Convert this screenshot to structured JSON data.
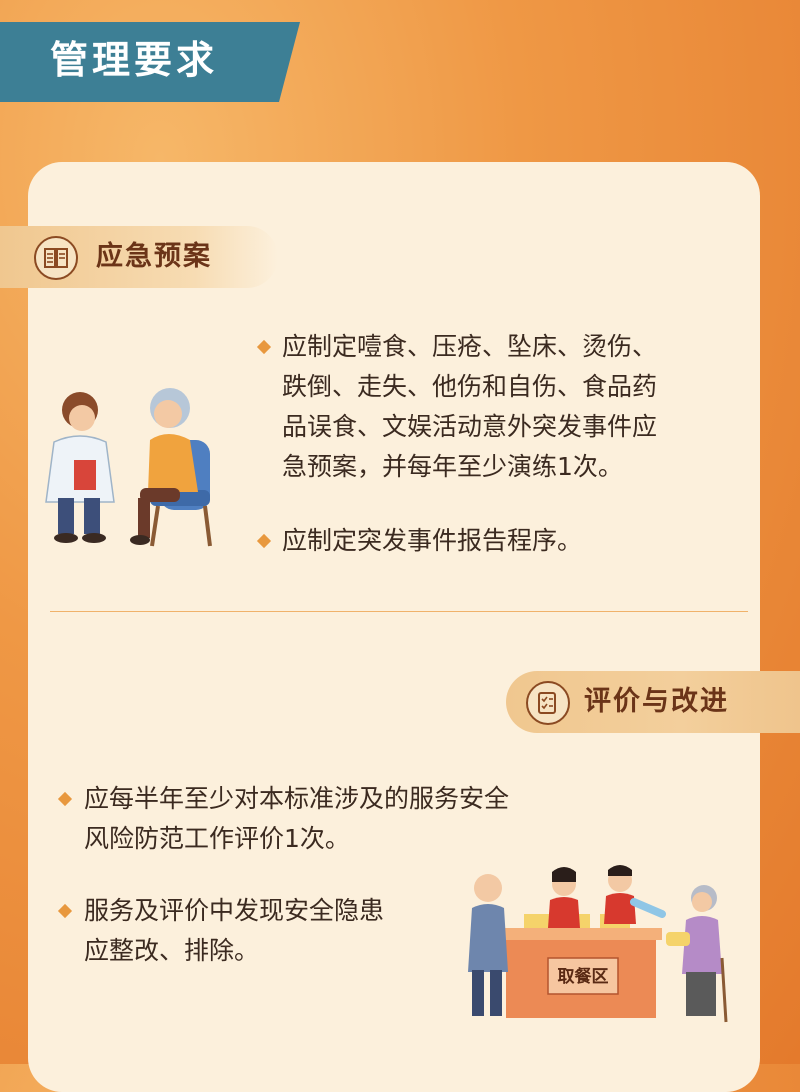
{
  "header": {
    "title": "管理要求"
  },
  "sections": [
    {
      "heading": "应急预案",
      "icon": "document-icon",
      "bullets": [
        {
          "lines": [
            "应制定噎食、压疮、坠床、烫伤、",
            "跌倒、走失、他伤和自伤、食品药",
            "品误食、文娱活动意外突发事件应",
            "急预案，并每年至少演练1次。"
          ]
        },
        {
          "lines": [
            "应制定突发事件报告程序。"
          ]
        }
      ]
    },
    {
      "heading": "评价与改进",
      "icon": "checklist-icon",
      "bullets": [
        {
          "lines": [
            "应每半年至少对本标准涉及的服务安全",
            "风险防范工作评价1次。"
          ]
        },
        {
          "lines": [
            "服务及评价中发现安全隐患",
            "应整改、排除。"
          ]
        }
      ]
    }
  ],
  "illustration": {
    "counter_sign": "取餐区"
  },
  "colors": {
    "banner": "#3d7f95",
    "card": "#fcf0dc",
    "accent": "#e8983e",
    "heading": "#6b3418"
  }
}
